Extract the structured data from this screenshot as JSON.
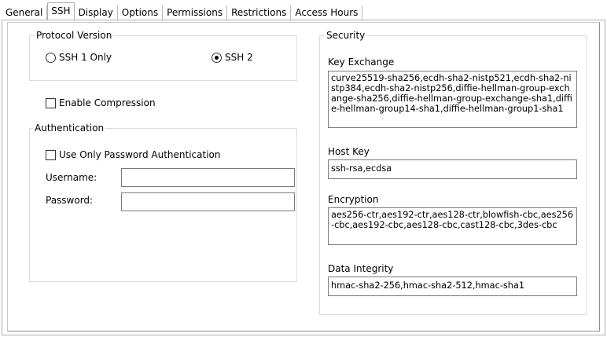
{
  "tabs": [
    "General",
    "SSH",
    "Display",
    "Options",
    "Permissions",
    "Restrictions",
    "Access Hours"
  ],
  "active_tab": "SSH",
  "protocol": {
    "legend": "Protocol Version",
    "ssh1_label": "SSH 1 Only",
    "ssh2_label": "SSH 2",
    "selected": "SSH 2"
  },
  "compression": {
    "label": "Enable Compression",
    "checked": false
  },
  "authentication": {
    "legend": "Authentication",
    "password_only_label": "Use Only Password Authentication",
    "password_only_checked": false,
    "username_label": "Username:",
    "username_value": "",
    "password_label": "Password:",
    "password_value": ""
  },
  "security": {
    "legend": "Security",
    "key_exchange_label": "Key Exchange",
    "key_exchange_value": "curve25519-sha256,ecdh-sha2-nistp521,ecdh-sha2-nistp384,ecdh-sha2-nistp256,diffie-hellman-group-exchange-sha256,diffie-hellman-group-exchange-sha1,diffie-hellman-group14-sha1,diffie-hellman-group1-sha1",
    "host_key_label": "Host Key",
    "host_key_value": "ssh-rsa,ecdsa",
    "encryption_label": "Encryption",
    "encryption_value": "aes256-ctr,aes192-ctr,aes128-ctr,blowfish-cbc,aes256-cbc,aes192-cbc,aes128-cbc,cast128-cbc,3des-cbc",
    "data_integrity_label": "Data Integrity",
    "data_integrity_value": "hmac-sha2-256,hmac-sha2-512,hmac-sha1"
  }
}
